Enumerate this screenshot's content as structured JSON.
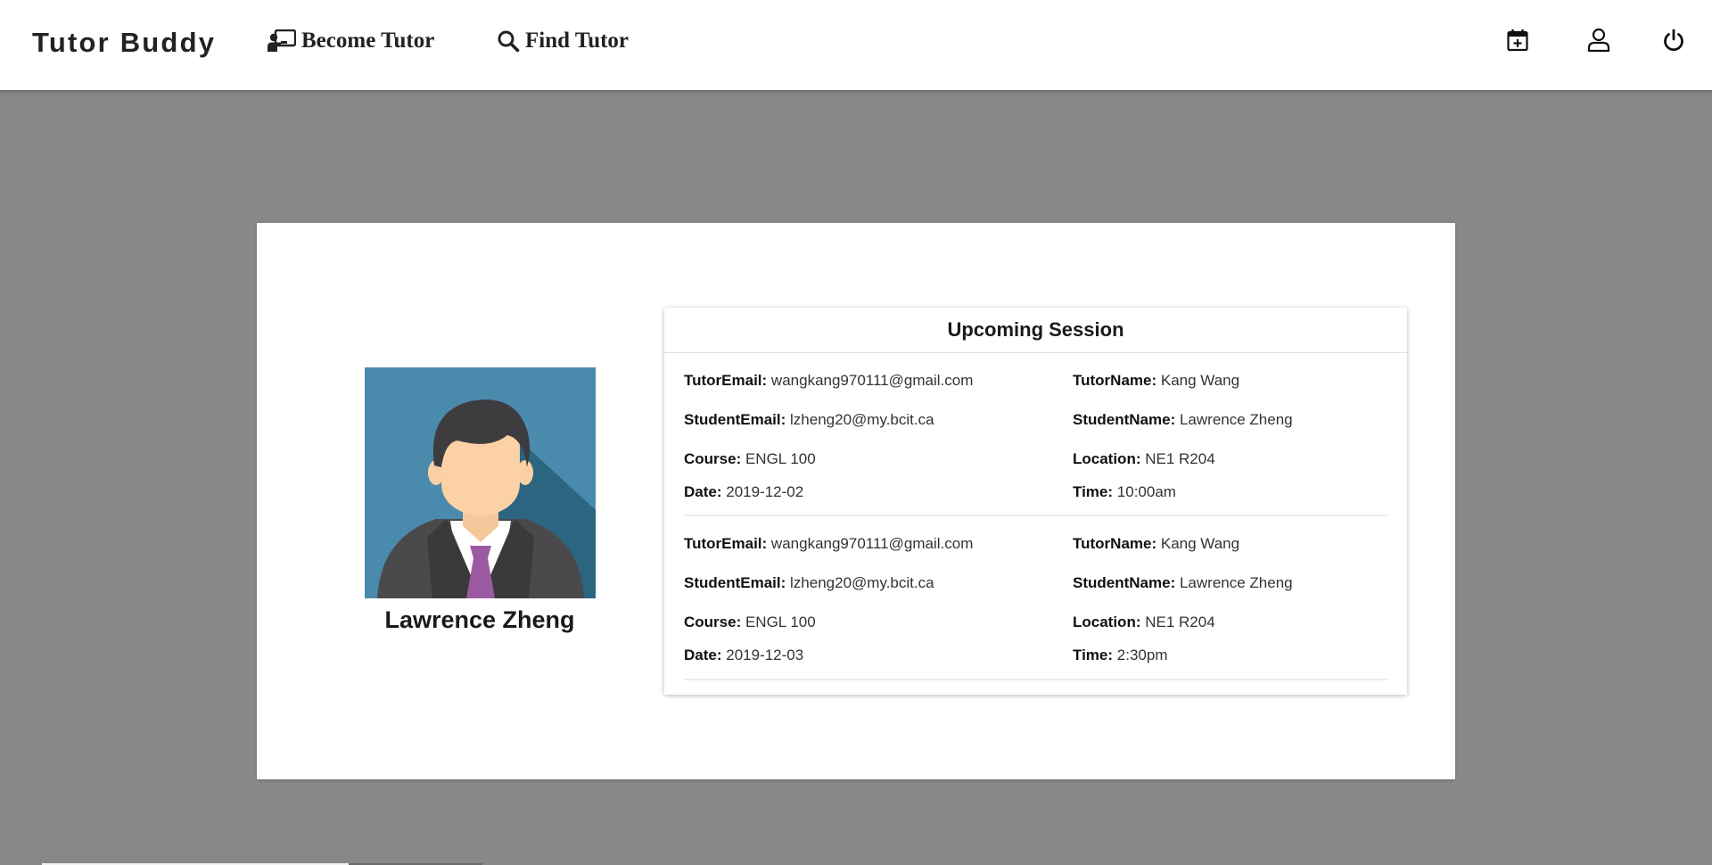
{
  "nav": {
    "brand": "Tutor Buddy",
    "become_tutor": "Become Tutor",
    "find_tutor": "Find Tutor",
    "icons": {
      "become_tutor": "chalkboard-teacher-icon",
      "find_tutor": "search-icon",
      "calendar": "calendar-plus-icon",
      "profile": "user-icon",
      "logout": "power-icon"
    }
  },
  "profile": {
    "name": "Lawrence Zheng"
  },
  "sessions": {
    "title": "Upcoming Session",
    "labels": {
      "tutor_email": "TutorEmail:",
      "tutor_name": "TutorName:",
      "student_email": "StudentEmail:",
      "student_name": "StudentName:",
      "course": "Course:",
      "location": "Location:",
      "date": "Date:",
      "time": "Time:"
    },
    "items": [
      {
        "tutor_email": "wangkang970111@gmail.com",
        "tutor_name": "Kang Wang",
        "student_email": "lzheng20@my.bcit.ca",
        "student_name": "Lawrence Zheng",
        "course": "ENGL 100",
        "location": "NE1 R204",
        "date": "2019-12-02",
        "time": "10:00am"
      },
      {
        "tutor_email": "wangkang970111@gmail.com",
        "tutor_name": "Kang Wang",
        "student_email": "lzheng20@my.bcit.ca",
        "student_name": "Lawrence Zheng",
        "course": "ENGL 100",
        "location": "NE1 R204",
        "date": "2019-12-03",
        "time": "2:30pm"
      }
    ]
  },
  "colors": {
    "page_background": "#898889",
    "avatar_background": "#4a8bad",
    "avatar_shadow": "#2b6580",
    "tie": "#9c5aa3",
    "suit": "#4a4a4c"
  }
}
